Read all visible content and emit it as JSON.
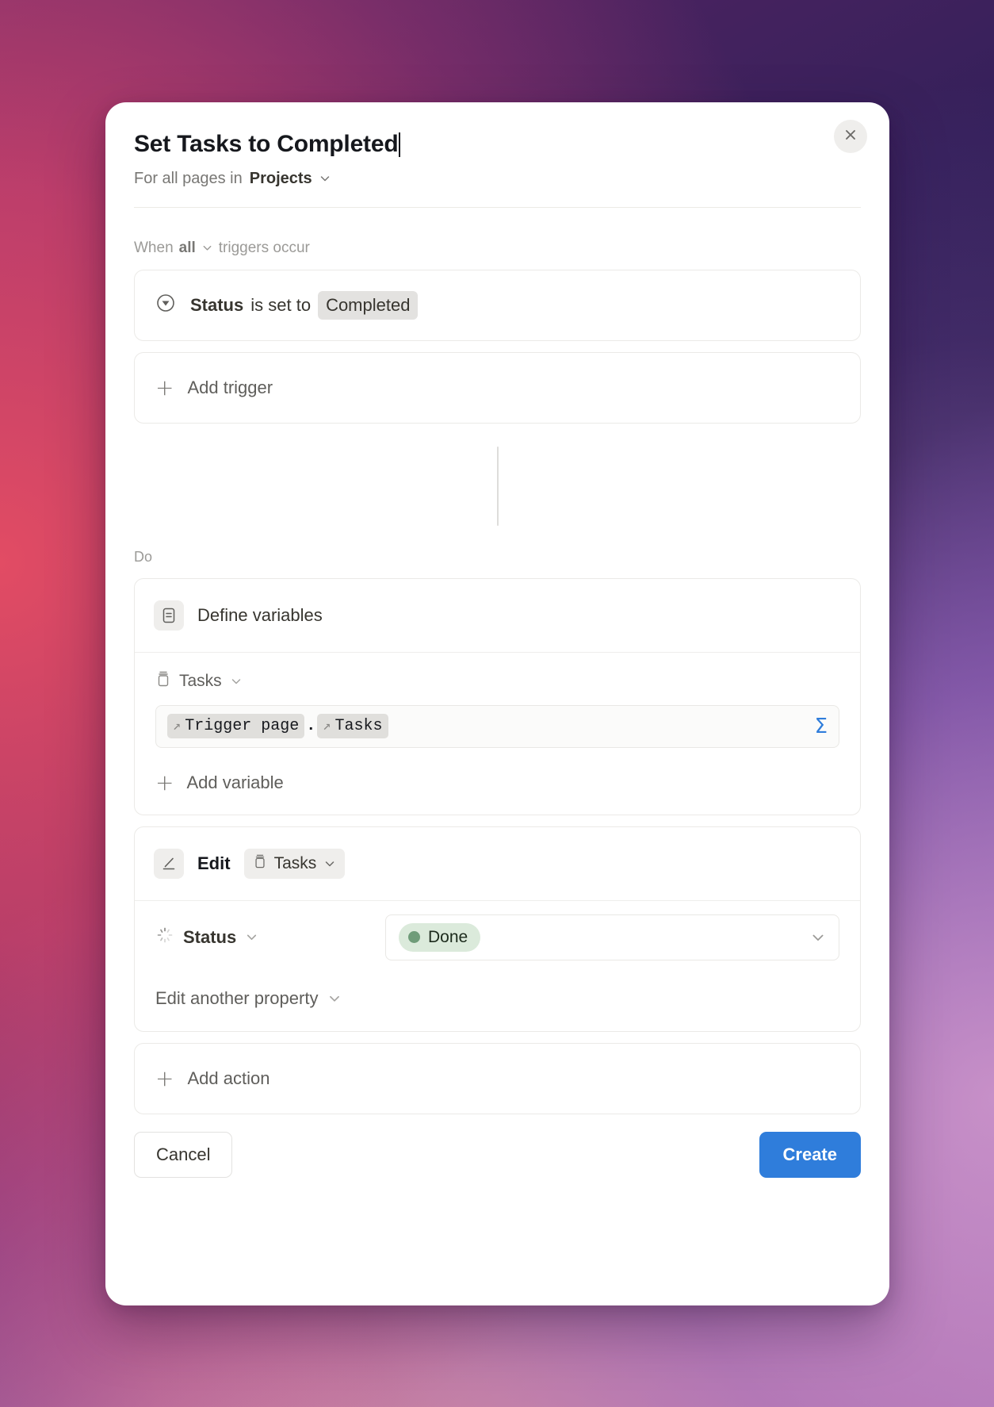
{
  "window": {
    "background_colors": [
      "#5b2a63",
      "#2c1f4e",
      "#e8556e",
      "#a87fbe",
      "#f3a0a0"
    ]
  },
  "modal": {
    "title": "Set Tasks to Completed",
    "subtitle_prefix": "For all pages in",
    "subtitle_database": "Projects",
    "close_icon": "close-icon",
    "database_chevron_icon": "chevron-down-icon"
  },
  "triggers": {
    "label_prefix": "When",
    "label_condition": "all",
    "label_suffix": "triggers occur",
    "condition_chevron_icon": "chevron-down-icon",
    "items": [
      {
        "icon": "status-circle-icon",
        "property": "Status",
        "operator": "is set to",
        "value": "Completed"
      }
    ],
    "add_label": "Add trigger",
    "add_icon": "plus-icon"
  },
  "actions": {
    "label": "Do",
    "define_variables": {
      "icon": "define-variables-icon",
      "title": "Define variables",
      "variable_name": "Tasks",
      "variable_icon": "database-icon",
      "variable_chevron_icon": "chevron-down-icon",
      "formula_tokens": [
        {
          "icon": "relation-arrow-icon",
          "label": "Trigger page"
        },
        {
          "icon": "relation-arrow-icon",
          "label": "Tasks"
        }
      ],
      "formula_separator": ".",
      "formula_icon": "sigma-icon",
      "add_variable_label": "Add variable",
      "add_variable_icon": "plus-icon"
    },
    "edit_action": {
      "icon": "edit-pencil-icon",
      "label": "Edit",
      "target": "Tasks",
      "target_icon": "database-icon",
      "target_chevron_icon": "chevron-down-icon",
      "property": {
        "icon": "status-spinner-icon",
        "name": "Status",
        "name_chevron_icon": "chevron-down-icon",
        "value": "Done",
        "value_color": "#dbeadb",
        "value_dot_color": "#6f9c79",
        "value_chevron_icon": "chevron-down-icon"
      },
      "edit_another_label": "Edit another property",
      "edit_another_chevron_icon": "chevron-down-icon"
    },
    "add_label": "Add action",
    "add_icon": "plus-icon"
  },
  "footer": {
    "cancel_label": "Cancel",
    "create_label": "Create",
    "create_color": "#2f7ddb"
  }
}
